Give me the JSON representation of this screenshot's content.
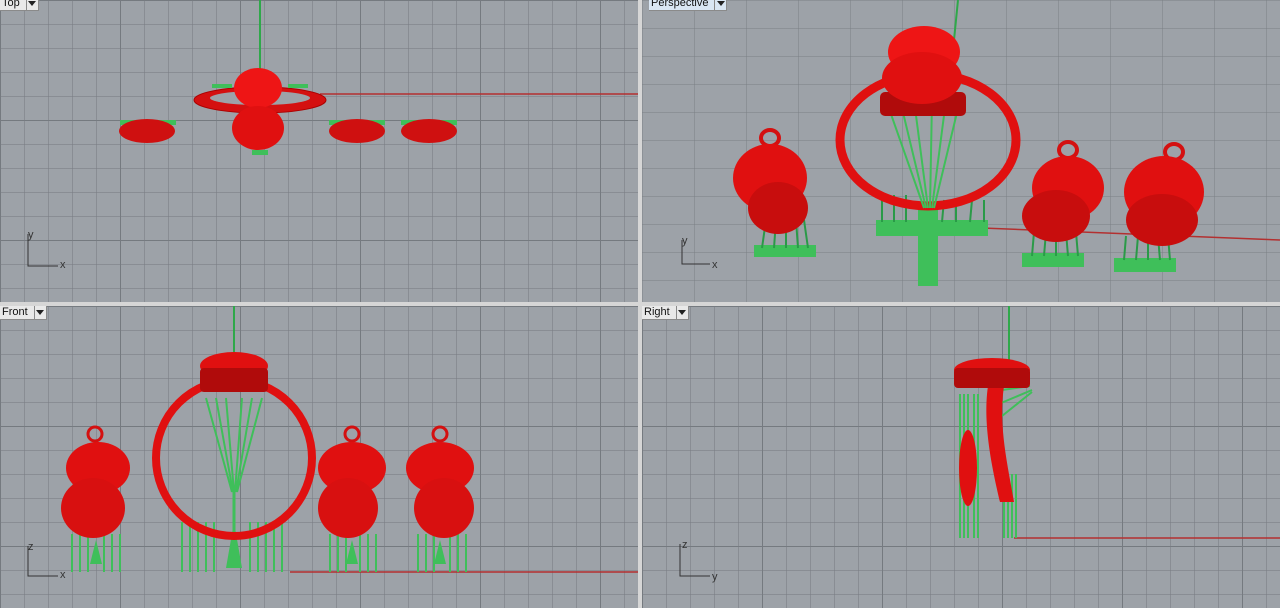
{
  "viewports": {
    "top": {
      "label": "Top",
      "axis_h": "x",
      "axis_v": "y"
    },
    "persp": {
      "label": "Perspective",
      "axis_h": "x",
      "axis_v": "y"
    },
    "front": {
      "label": "Front",
      "axis_h": "x",
      "axis_v": "z"
    },
    "right": {
      "label": "Right",
      "axis_h": "y",
      "axis_v": "z"
    }
  },
  "colors": {
    "model_red": "#e01010",
    "support_green": "#3fbf5a",
    "axis_red": "#b33030",
    "axis_green": "#2fa84a",
    "grid_bg": "#9da2a8"
  },
  "icons": {
    "viewport_menu": "chevron-down-icon",
    "axis_widget": "axis-icon"
  }
}
